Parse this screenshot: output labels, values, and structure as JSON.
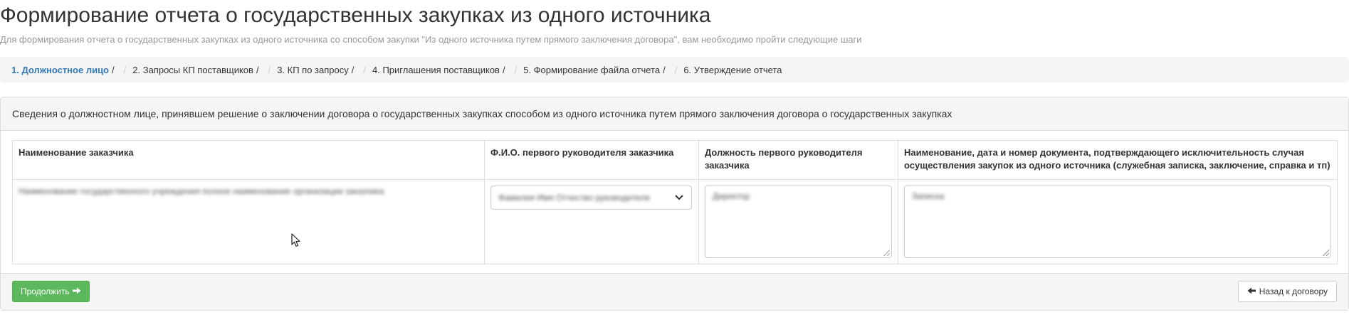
{
  "page": {
    "title": "Формирование отчета о государственных закупках из одного источника",
    "subtitle": "Для формирования отчета о государственных закупках из одного источника со способом закупки \"Из одного источника путем прямого заключения договора\", вам необходимо пройти следующие шаги"
  },
  "breadcrumb": {
    "steps": [
      {
        "label": "1. Должностное лицо"
      },
      {
        "label": "2. Запросы КП поставщиков"
      },
      {
        "label": "3. КП по запросу"
      },
      {
        "label": "4. Приглашения поставщиков"
      },
      {
        "label": "5. Формирование файла отчета"
      },
      {
        "label": "6. Утверждение отчета"
      }
    ],
    "separator": "/"
  },
  "panel": {
    "heading": "Сведения о должностном лице, принявшем решение о заключении договора о государственных закупках способом из одного источника путем прямого заключения договора о государственных закупках",
    "table": {
      "headers": [
        "Наименование заказчика",
        "Ф.И.О. первого руководителя заказчика",
        "Должность первого руководителя заказчика",
        "Наименование, дата и номер документа, подтверждающего исключительность случая осуществления закупок из одного источника (служебная записка, заключение, справка и тп)"
      ],
      "row": {
        "customer_name": "Наименование государственного учреждения полное наименование организации заказчика",
        "director_select_value": "Фамилия Имя Отчество руководителя",
        "position_value": "Директор",
        "document_value": "Записка"
      }
    }
  },
  "footer": {
    "continue_label": "Продолжить",
    "back_label": "Назад к договору"
  }
}
